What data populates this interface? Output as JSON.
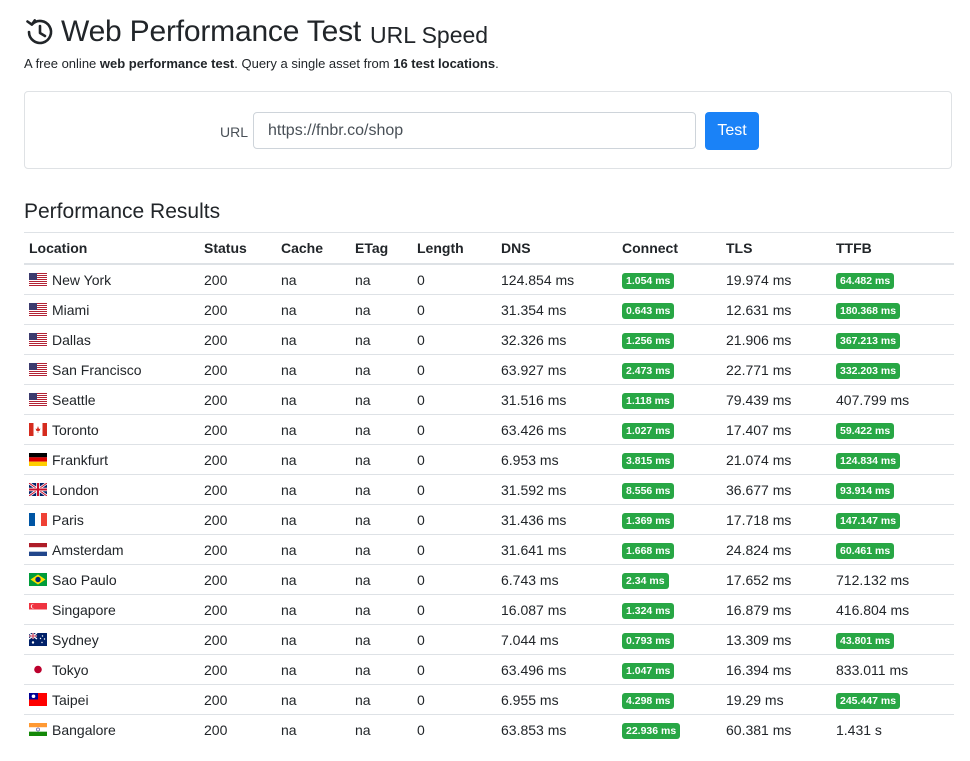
{
  "header": {
    "title": "Web Performance Test",
    "subtitle": "URL Speed",
    "tagline_prefix": "A free online ",
    "tagline_bold1": "web performance test",
    "tagline_mid": ". Query a single asset from ",
    "tagline_bold2": "16 test locations",
    "tagline_suffix": "."
  },
  "form": {
    "url_label": "URL",
    "url_value": "https://fnbr.co/shop",
    "test_button": "Test"
  },
  "results": {
    "title": "Performance Results",
    "columns": [
      "Location",
      "Status",
      "Cache",
      "ETag",
      "Length",
      "DNS",
      "Connect",
      "TLS",
      "TTFB"
    ],
    "rows": [
      {
        "flag": "us",
        "location": "New York",
        "status": "200",
        "cache": "na",
        "etag": "na",
        "length": "0",
        "dns": "124.854 ms",
        "connect": "1.054 ms",
        "connect_badge": true,
        "tls": "19.974 ms",
        "ttfb": "64.482 ms",
        "ttfb_badge": true
      },
      {
        "flag": "us",
        "location": "Miami",
        "status": "200",
        "cache": "na",
        "etag": "na",
        "length": "0",
        "dns": "31.354 ms",
        "connect": "0.643 ms",
        "connect_badge": true,
        "tls": "12.631 ms",
        "ttfb": "180.368 ms",
        "ttfb_badge": true
      },
      {
        "flag": "us",
        "location": "Dallas",
        "status": "200",
        "cache": "na",
        "etag": "na",
        "length": "0",
        "dns": "32.326 ms",
        "connect": "1.256 ms",
        "connect_badge": true,
        "tls": "21.906 ms",
        "ttfb": "367.213 ms",
        "ttfb_badge": true
      },
      {
        "flag": "us",
        "location": "San Francisco",
        "status": "200",
        "cache": "na",
        "etag": "na",
        "length": "0",
        "dns": "63.927 ms",
        "connect": "2.473 ms",
        "connect_badge": true,
        "tls": "22.771 ms",
        "ttfb": "332.203 ms",
        "ttfb_badge": true
      },
      {
        "flag": "us",
        "location": "Seattle",
        "status": "200",
        "cache": "na",
        "etag": "na",
        "length": "0",
        "dns": "31.516 ms",
        "connect": "1.118 ms",
        "connect_badge": true,
        "tls": "79.439 ms",
        "ttfb": "407.799 ms",
        "ttfb_badge": false
      },
      {
        "flag": "ca",
        "location": "Toronto",
        "status": "200",
        "cache": "na",
        "etag": "na",
        "length": "0",
        "dns": "63.426 ms",
        "connect": "1.027 ms",
        "connect_badge": true,
        "tls": "17.407 ms",
        "ttfb": "59.422 ms",
        "ttfb_badge": true
      },
      {
        "flag": "de",
        "location": "Frankfurt",
        "status": "200",
        "cache": "na",
        "etag": "na",
        "length": "0",
        "dns": "6.953 ms",
        "connect": "3.815 ms",
        "connect_badge": true,
        "tls": "21.074 ms",
        "ttfb": "124.834 ms",
        "ttfb_badge": true
      },
      {
        "flag": "gb",
        "location": "London",
        "status": "200",
        "cache": "na",
        "etag": "na",
        "length": "0",
        "dns": "31.592 ms",
        "connect": "8.556 ms",
        "connect_badge": true,
        "tls": "36.677 ms",
        "ttfb": "93.914 ms",
        "ttfb_badge": true
      },
      {
        "flag": "fr",
        "location": "Paris",
        "status": "200",
        "cache": "na",
        "etag": "na",
        "length": "0",
        "dns": "31.436 ms",
        "connect": "1.369 ms",
        "connect_badge": true,
        "tls": "17.718 ms",
        "ttfb": "147.147 ms",
        "ttfb_badge": true
      },
      {
        "flag": "nl",
        "location": "Amsterdam",
        "status": "200",
        "cache": "na",
        "etag": "na",
        "length": "0",
        "dns": "31.641 ms",
        "connect": "1.668 ms",
        "connect_badge": true,
        "tls": "24.824 ms",
        "ttfb": "60.461 ms",
        "ttfb_badge": true
      },
      {
        "flag": "br",
        "location": "Sao Paulo",
        "status": "200",
        "cache": "na",
        "etag": "na",
        "length": "0",
        "dns": "6.743 ms",
        "connect": "2.34 ms",
        "connect_badge": true,
        "tls": "17.652 ms",
        "ttfb": "712.132 ms",
        "ttfb_badge": false
      },
      {
        "flag": "sg",
        "location": "Singapore",
        "status": "200",
        "cache": "na",
        "etag": "na",
        "length": "0",
        "dns": "16.087 ms",
        "connect": "1.324 ms",
        "connect_badge": true,
        "tls": "16.879 ms",
        "ttfb": "416.804 ms",
        "ttfb_badge": false
      },
      {
        "flag": "au",
        "location": "Sydney",
        "status": "200",
        "cache": "na",
        "etag": "na",
        "length": "0",
        "dns": "7.044 ms",
        "connect": "0.793 ms",
        "connect_badge": true,
        "tls": "13.309 ms",
        "ttfb": "43.801 ms",
        "ttfb_badge": true
      },
      {
        "flag": "jp",
        "location": "Tokyo",
        "status": "200",
        "cache": "na",
        "etag": "na",
        "length": "0",
        "dns": "63.496 ms",
        "connect": "1.047 ms",
        "connect_badge": true,
        "tls": "16.394 ms",
        "ttfb": "833.011 ms",
        "ttfb_badge": false
      },
      {
        "flag": "tw",
        "location": "Taipei",
        "status": "200",
        "cache": "na",
        "etag": "na",
        "length": "0",
        "dns": "6.955 ms",
        "connect": "4.298 ms",
        "connect_badge": true,
        "tls": "19.29 ms",
        "ttfb": "245.447 ms",
        "ttfb_badge": true
      },
      {
        "flag": "in",
        "location": "Bangalore",
        "status": "200",
        "cache": "na",
        "etag": "na",
        "length": "0",
        "dns": "63.853 ms",
        "connect": "22.936 ms",
        "connect_badge": true,
        "tls": "60.381 ms",
        "ttfb": "1.431 s",
        "ttfb_badge": false
      }
    ]
  },
  "colors": {
    "badge_green": "#28a745",
    "button_blue": "#1a82f7"
  }
}
